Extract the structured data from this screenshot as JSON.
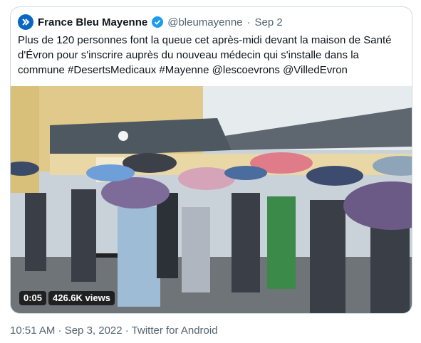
{
  "tweet": {
    "author_name": "France Bleu Mayenne",
    "handle": "@bleumayenne",
    "separator": "·",
    "date": "Sep 2",
    "text": "Plus de 120 personnes font la queue cet après-midi devant la maison de Santé d'Évron pour s'inscrire auprès du nouveau médecin qui s'installe dans la commune #DesertsMedicaux #Mayenne @lescoevrons @VilledEvron",
    "video": {
      "duration": "0:05",
      "views": "426.6K views"
    },
    "footer": "10:51 AM · Sep 3, 2022 · Twitter for Android"
  },
  "icons": {
    "avatar": "france-bleu-logo-icon",
    "verified": "verified-badge-icon"
  },
  "colors": {
    "verified": "#1d9bf0",
    "border": "#cfd9de",
    "muted": "#536471"
  }
}
